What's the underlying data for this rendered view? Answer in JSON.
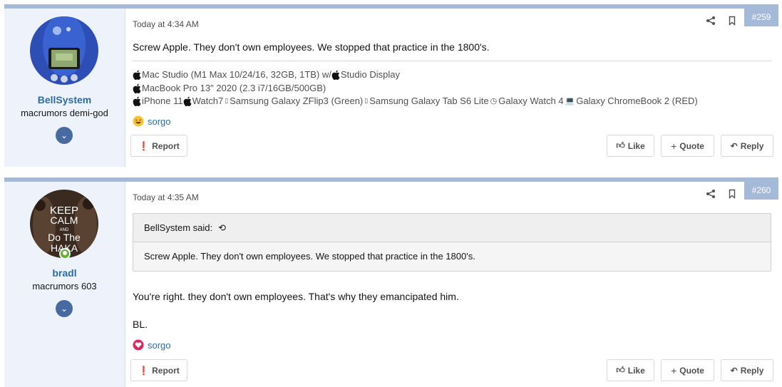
{
  "posts": [
    {
      "username": "BellSystem",
      "user_title": "macrumors demi-god",
      "date": "Today at 4:34 AM",
      "number": "#259",
      "message": "Screw Apple. They don't own employees. We stopped that practice in the 1800's.",
      "signature": {
        "line1_a": "Mac Studio (M1 Max 10/24/16, 32GB, 1TB) w/ ",
        "line1_b": "Studio Display",
        "line2": " MacBook Pro 13\" 2020 (2.3 i7/16GB/500GB)",
        "line3_a": "iPhone 11 ",
        "line3_b": " Watch7 ",
        "line3_c": "Samsung Galaxy ZFlip3 (Green) ",
        "line3_d": "Samsung Galaxy Tab S6 Lite ",
        "line3_e": "Galaxy Watch 4 ",
        "line3_f": "Galaxy ChromeBook 2 (RED)"
      },
      "reaction_user": "sorgo",
      "reaction_type": "haha-icon"
    },
    {
      "username": "bradl",
      "user_title": "macrumors 603",
      "date": "Today at 4:35 AM",
      "number": "#260",
      "quote_author": "BellSystem said:",
      "quote_text": "Screw Apple. They don't own employees. We stopped that practice in the 1800's.",
      "message": "You're right. they don't own employees. That's why they emancipated him.",
      "message2": "BL.",
      "reaction_user": "sorgo",
      "reaction_type": "love-icon",
      "avatar_text": [
        "KEEP",
        "CALM",
        "AND",
        "Do The",
        "HAKA"
      ]
    }
  ],
  "actions": {
    "report": "Report",
    "like": "Like",
    "quote": "Quote",
    "reply": "Reply"
  },
  "colors": {
    "accent": "#a5b9d8",
    "username": "#2b6ca3",
    "user_cell": "#eef3fb"
  }
}
